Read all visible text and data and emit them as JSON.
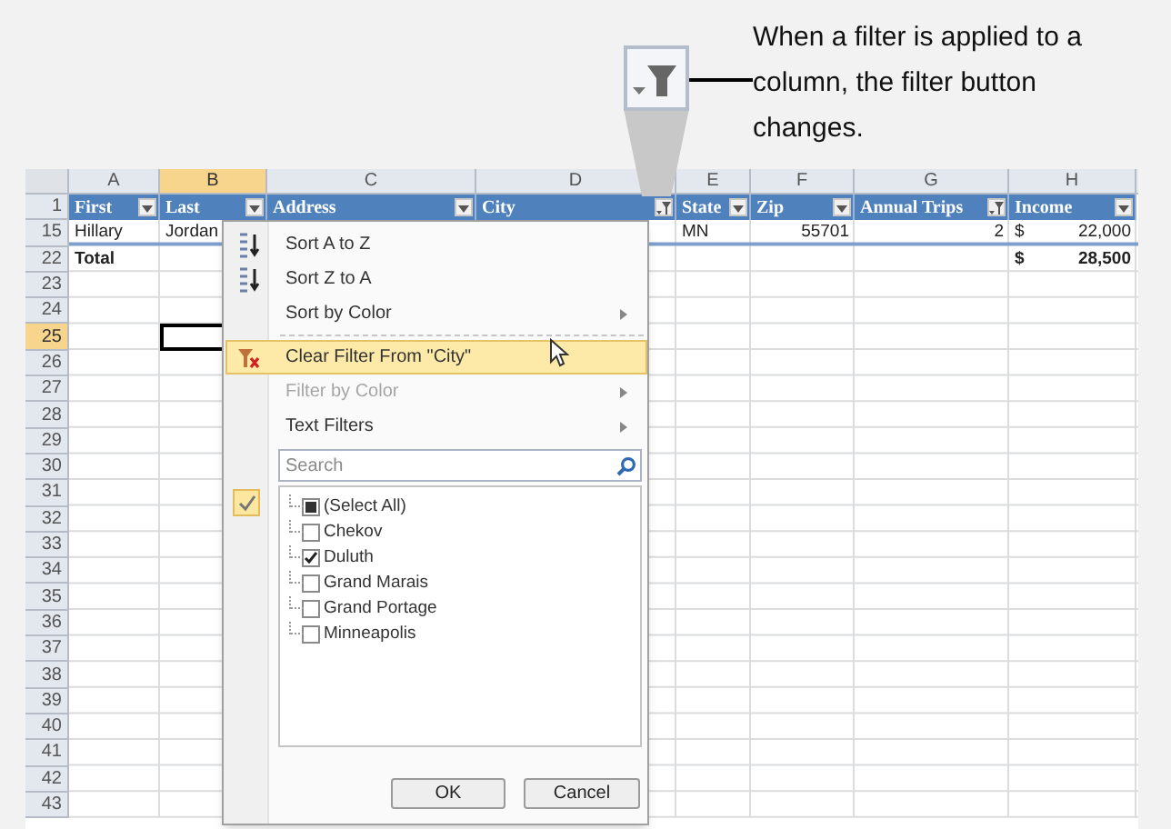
{
  "callout": {
    "text": "When a filter is applied to a column, the filter button changes."
  },
  "column_letters": [
    {
      "label": "A",
      "selected": false
    },
    {
      "label": "B",
      "selected": true
    },
    {
      "label": "C",
      "selected": false
    },
    {
      "label": "D",
      "selected": false
    },
    {
      "label": "E",
      "selected": false
    },
    {
      "label": "F",
      "selected": false
    },
    {
      "label": "G",
      "selected": false
    },
    {
      "label": "H",
      "selected": false
    }
  ],
  "header_row": {
    "number": "1",
    "cells": [
      {
        "label": "First",
        "filter_applied": false
      },
      {
        "label": "Last",
        "filter_applied": false
      },
      {
        "label": "Address",
        "filter_applied": false
      },
      {
        "label": "City",
        "filter_applied": true
      },
      {
        "label": "State",
        "filter_applied": false
      },
      {
        "label": "Zip",
        "filter_applied": false
      },
      {
        "label": "Annual Trips",
        "filter_applied": true
      },
      {
        "label": "Income",
        "filter_applied": false
      }
    ]
  },
  "rows": [
    {
      "number": "15",
      "selected": false,
      "kind": "data",
      "cells": [
        "Hillary",
        "Jordan",
        "",
        "",
        "MN",
        "55701",
        "2",
        "22,000"
      ],
      "currency_symbol": "$"
    },
    {
      "number": "22",
      "selected": false,
      "kind": "total",
      "cells": [
        "Total",
        "",
        "",
        "",
        "",
        "",
        "",
        "28,500"
      ],
      "currency_symbol": "$"
    },
    {
      "number": "23",
      "selected": false,
      "kind": "empty",
      "cells": []
    },
    {
      "number": "24",
      "selected": false,
      "kind": "empty",
      "cells": []
    },
    {
      "number": "25",
      "selected": true,
      "kind": "empty",
      "cells": []
    },
    {
      "number": "26",
      "selected": false,
      "kind": "empty",
      "cells": []
    },
    {
      "number": "27",
      "selected": false,
      "kind": "empty",
      "cells": []
    },
    {
      "number": "28",
      "selected": false,
      "kind": "empty",
      "cells": []
    },
    {
      "number": "29",
      "selected": false,
      "kind": "empty",
      "cells": []
    },
    {
      "number": "30",
      "selected": false,
      "kind": "empty",
      "cells": []
    },
    {
      "number": "31",
      "selected": false,
      "kind": "empty",
      "cells": []
    },
    {
      "number": "32",
      "selected": false,
      "kind": "empty",
      "cells": []
    },
    {
      "number": "33",
      "selected": false,
      "kind": "empty",
      "cells": []
    },
    {
      "number": "34",
      "selected": false,
      "kind": "empty",
      "cells": []
    },
    {
      "number": "35",
      "selected": false,
      "kind": "empty",
      "cells": []
    },
    {
      "number": "36",
      "selected": false,
      "kind": "empty",
      "cells": []
    },
    {
      "number": "37",
      "selected": false,
      "kind": "empty",
      "cells": []
    },
    {
      "number": "38",
      "selected": false,
      "kind": "empty",
      "cells": []
    },
    {
      "number": "39",
      "selected": false,
      "kind": "empty",
      "cells": []
    },
    {
      "number": "40",
      "selected": false,
      "kind": "empty",
      "cells": []
    },
    {
      "number": "41",
      "selected": false,
      "kind": "empty",
      "cells": []
    },
    {
      "number": "42",
      "selected": false,
      "kind": "empty",
      "cells": []
    },
    {
      "number": "43",
      "selected": false,
      "kind": "empty",
      "cells": []
    }
  ],
  "filter_menu": {
    "items": [
      {
        "kind": "sort_az",
        "label": "Sort A to Z",
        "disabled": false,
        "highlighted": false,
        "submenu": false
      },
      {
        "kind": "sort_za",
        "label": "Sort Z to A",
        "disabled": false,
        "highlighted": false,
        "submenu": false
      },
      {
        "kind": "plain",
        "label": "Sort by Color",
        "disabled": false,
        "highlighted": false,
        "submenu": true
      },
      {
        "kind": "separator"
      },
      {
        "kind": "clear",
        "label": "Clear Filter From \"City\"",
        "disabled": false,
        "highlighted": true,
        "submenu": false
      },
      {
        "kind": "plain",
        "label": "Filter by Color",
        "disabled": true,
        "highlighted": false,
        "submenu": true
      },
      {
        "kind": "plain",
        "label": "Text Filters",
        "disabled": false,
        "highlighted": false,
        "submenu": true
      }
    ],
    "search": {
      "placeholder": "Search"
    },
    "values": [
      {
        "label": "(Select All)",
        "checked": false,
        "indeterminate": true
      },
      {
        "label": "Chekov",
        "checked": false,
        "indeterminate": false
      },
      {
        "label": "Duluth",
        "checked": true,
        "indeterminate": false
      },
      {
        "label": "Grand Marais",
        "checked": false,
        "indeterminate": false
      },
      {
        "label": "Grand Portage",
        "checked": false,
        "indeterminate": false
      },
      {
        "label": "Minneapolis",
        "checked": false,
        "indeterminate": false
      }
    ],
    "buttons": [
      "OK",
      "Cancel"
    ]
  }
}
